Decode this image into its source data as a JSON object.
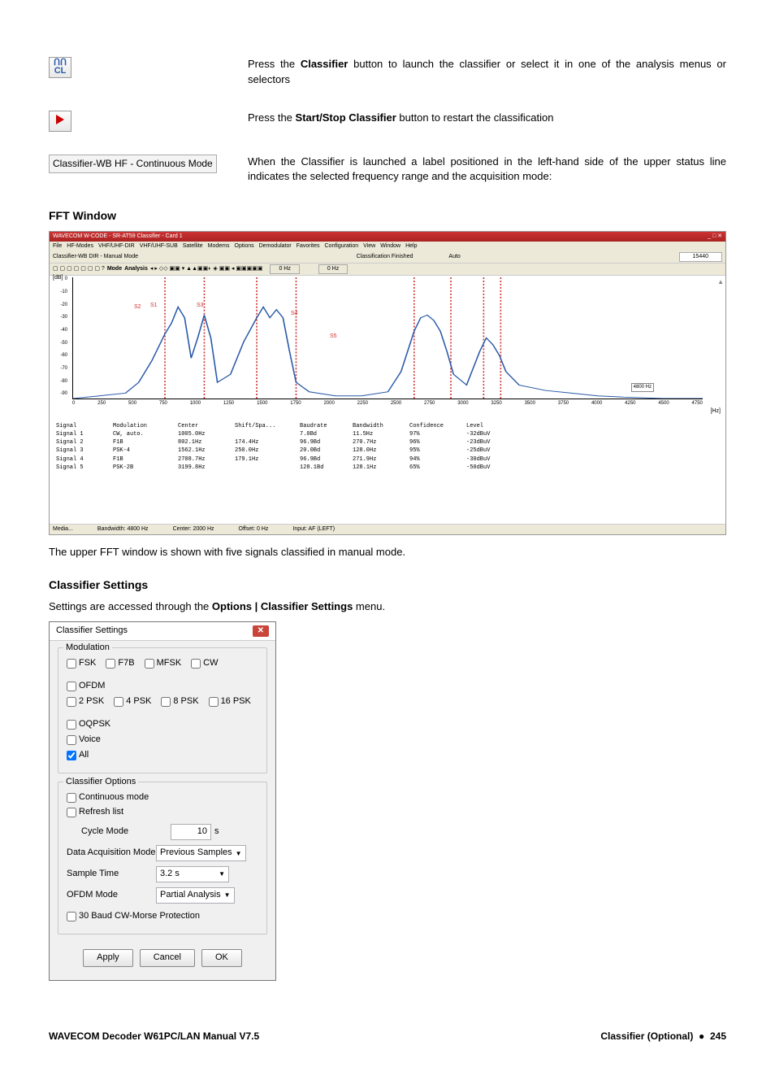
{
  "row1": {
    "pre": "Press the ",
    "bold": "Classifier",
    "post": " button to launch the classifier or select it in one of the analysis menus or selectors"
  },
  "row2": {
    "pre": "Press the ",
    "bold": "Start/Stop Classifier",
    "post": " button to restart the classification"
  },
  "row3": {
    "chip": "Classifier-WB HF - Continuous Mode",
    "text": "When the Classifier is launched a label positioned in the left-hand side of the upper status line indicates the selected frequency range and the acquisition mode:"
  },
  "fft_heading": "FFT Window",
  "fft_caption": "The upper FFT window is shown with five signals classified in manual mode.",
  "settings_heading": "Classifier Settings",
  "settings_intro_pre": "Settings are accessed through the ",
  "settings_intro_bold": "Options | Classifier Settings",
  "settings_intro_post": " menu.",
  "screenshot": {
    "title": "WAVECOM W-CODE - SR-AT59 Classifier - Card 1",
    "menus": [
      "File",
      "HF-Modes",
      "VHF/UHF-DIR",
      "VHF/UHF-SUB",
      "Satellite",
      "Modems",
      "Options",
      "Demodulator",
      "Favorites",
      "Configuration",
      "View",
      "Window",
      "Help"
    ],
    "mode_line": "Classifier-WB DIR - Manual Mode",
    "mode_status": "Classification Finished",
    "mode_auto": "Auto",
    "mode_freq": "15440",
    "toolbar_labels": [
      "Mode",
      "Analysis"
    ],
    "toolbar_right1": "0 Hz",
    "toolbar_right2": "0 Hz",
    "dbaxis_label": "[dB]",
    "hz_label": "[Hz]",
    "y_ticks": [
      "0",
      "-10",
      "-20",
      "-30",
      "-40",
      "-50",
      "-60",
      "-70",
      "-80",
      "-90"
    ],
    "x_ticks": [
      "0",
      "250",
      "500",
      "750",
      "1000",
      "1250",
      "1500",
      "1750",
      "2000",
      "2250",
      "2500",
      "2750",
      "3000",
      "3250",
      "3500",
      "3750",
      "4000",
      "4250",
      "4500",
      "4750"
    ],
    "sig_markers": [
      "S1",
      "S2",
      "S3",
      "S4",
      "S5"
    ],
    "bw_badge": "4800 Hz",
    "table_header": [
      "Signal",
      "Modulation",
      "Center",
      "Shift/Spa...",
      "Baudrate",
      "Bandwidth",
      "Confidence",
      "Level"
    ],
    "table_rows": [
      [
        "Signal 1",
        "CW, auto.",
        "1005.0Hz",
        "",
        "7.0Bd",
        "11.5Hz",
        "97%",
        "-32dBuV"
      ],
      [
        "Signal 2",
        "F1B",
        "802.1Hz",
        "174.4Hz",
        "96.9Bd",
        "270.7Hz",
        "96%",
        "-23dBuV"
      ],
      [
        "Signal 3",
        "PSK-4",
        "1562.1Hz",
        "250.0Hz",
        "20.0Bd",
        "128.0Hz",
        "95%",
        "-25dBuV"
      ],
      [
        "Signal 4",
        "F1B",
        "2708.7Hz",
        "179.1Hz",
        "96.9Bd",
        "271.9Hz",
        "94%",
        "-30dBuV"
      ],
      [
        "Signal 5",
        "PSK-2B",
        "3199.8Hz",
        "",
        "128.1Bd",
        "128.1Hz",
        "65%",
        "-50dBuV"
      ]
    ],
    "status_items": [
      "Media...",
      "Bandwidth: 4800 Hz",
      "Center: 2000 Hz",
      "Offset: 0 Hz",
      "Input: AF (LEFT)"
    ]
  },
  "dialog": {
    "title": "Classifier Settings",
    "group1": {
      "title": "Modulation",
      "cbs": [
        "FSK",
        "F7B",
        "MFSK",
        "CW",
        "OFDM",
        "2 PSK",
        "4 PSK",
        "8 PSK",
        "16 PSK",
        "OQPSK",
        "Voice",
        "All"
      ]
    },
    "group2": {
      "title": "Classifier Options",
      "continuous": "Continuous mode",
      "refresh": "Refresh list",
      "cycle_label": "Cycle Mode",
      "cycle_value": "10",
      "cycle_unit": "s",
      "data_acq_label": "Data Acquisition Mode",
      "data_acq_value": "Previous Samples",
      "sample_time_label": "Sample Time",
      "sample_time_value": "3.2 s",
      "ofdm_label": "OFDM Mode",
      "ofdm_value": "Partial Analysis",
      "protection": "30 Baud CW-Morse Protection"
    },
    "buttons": {
      "apply": "Apply",
      "cancel": "Cancel",
      "ok": "OK"
    }
  },
  "footer": {
    "left": "WAVECOM Decoder W61PC/LAN Manual V7.5",
    "right_section": "Classifier (Optional)",
    "dot": "●",
    "page": "245"
  },
  "chart_data": {
    "type": "line",
    "title": "FFT Spectrum",
    "xlabel": "Hz",
    "ylabel": "dB",
    "xlim": [
      0,
      4800
    ],
    "ylim": [
      -90,
      0
    ],
    "markers": [
      {
        "name": "S1",
        "x": 1005
      },
      {
        "name": "S2",
        "x": 802
      },
      {
        "name": "S3",
        "x": 1562
      },
      {
        "name": "S4",
        "x": 2709
      },
      {
        "name": "S5",
        "x": 3200
      }
    ],
    "series": [
      {
        "name": "spectrum",
        "x": [
          0,
          200,
          400,
          500,
          600,
          700,
          750,
          800,
          850,
          900,
          950,
          1000,
          1050,
          1100,
          1200,
          1300,
          1400,
          1450,
          1500,
          1550,
          1600,
          1650,
          1700,
          1800,
          2000,
          2200,
          2400,
          2500,
          2600,
          2650,
          2700,
          2750,
          2800,
          2850,
          2900,
          3000,
          3100,
          3150,
          3200,
          3250,
          3300,
          3400,
          3600,
          3800,
          4000,
          4200,
          4500,
          4800
        ],
        "y": [
          -90,
          -88,
          -86,
          -78,
          -62,
          -42,
          -34,
          -22,
          -30,
          -60,
          -45,
          -28,
          -45,
          -78,
          -72,
          -48,
          -30,
          -22,
          -30,
          -24,
          -30,
          -55,
          -78,
          -85,
          -88,
          -88,
          -85,
          -70,
          -40,
          -30,
          -28,
          -32,
          -40,
          -55,
          -72,
          -80,
          -55,
          -45,
          -50,
          -58,
          -70,
          -80,
          -84,
          -86,
          -88,
          -89,
          -90,
          -90
        ]
      }
    ]
  }
}
